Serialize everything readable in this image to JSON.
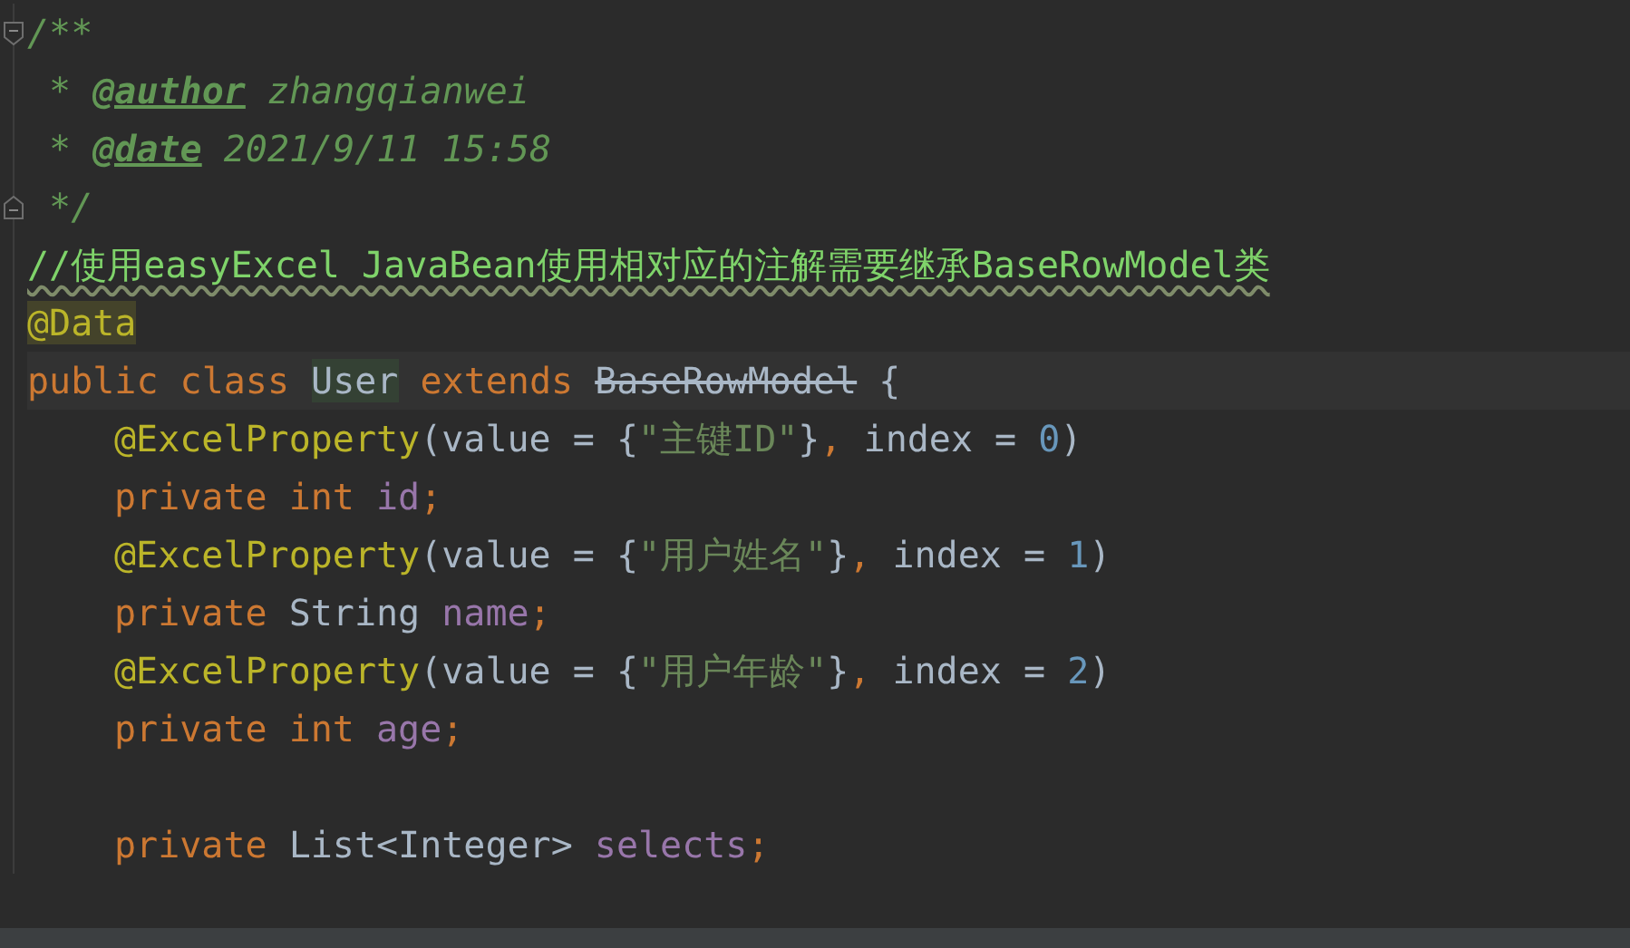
{
  "editor": {
    "lines": [
      {
        "fold_start": true,
        "fold_end": false,
        "kind": "normal",
        "indented": false,
        "tokens": [
          {
            "text": "/**",
            "kind": "doc"
          }
        ]
      },
      {
        "fold_start": false,
        "fold_end": false,
        "kind": "normal",
        "indented": false,
        "tokens": [
          {
            "text": " * ",
            "kind": "doc"
          },
          {
            "text": "@author",
            "kind": "doc-tag"
          },
          {
            "text": " zhangqianwei",
            "kind": "doc"
          }
        ]
      },
      {
        "fold_start": false,
        "fold_end": false,
        "kind": "normal",
        "indented": false,
        "tokens": [
          {
            "text": " * ",
            "kind": "doc"
          },
          {
            "text": "@date",
            "kind": "doc-tag"
          },
          {
            "text": " 2021/9/11 15:58",
            "kind": "doc"
          }
        ]
      },
      {
        "fold_start": false,
        "fold_end": true,
        "kind": "normal",
        "indented": false,
        "tokens": [
          {
            "text": " */",
            "kind": "doc"
          }
        ]
      },
      {
        "fold_start": false,
        "fold_end": false,
        "kind": "normal",
        "indented": false,
        "tokens": [
          {
            "text": "//使用easyExcel JavaBean使用相对应的注解需要继承BaseRowModel类",
            "kind": "line-comment"
          }
        ]
      },
      {
        "fold_start": false,
        "fold_end": false,
        "kind": "normal",
        "indented": false,
        "tokens": [
          {
            "text": "@Data",
            "kind": "annotation-marked"
          }
        ]
      },
      {
        "fold_start": false,
        "fold_end": false,
        "kind": "caret-line",
        "indented": false,
        "tokens": [
          {
            "text": "public class ",
            "kind": "keyword"
          },
          {
            "text": "User",
            "kind": "name-marked"
          },
          {
            "text": " extends ",
            "kind": "keyword"
          },
          {
            "text": "BaseRowModel",
            "kind": "deprecated"
          },
          {
            "text": " {",
            "kind": "plain"
          }
        ]
      },
      {
        "fold_start": false,
        "fold_end": false,
        "kind": "normal",
        "indented": true,
        "tokens": [
          {
            "text": "@ExcelProperty",
            "kind": "annotation"
          },
          {
            "text": "(value = {",
            "kind": "plain"
          },
          {
            "text": "\"主键ID\"",
            "kind": "string"
          },
          {
            "text": "}",
            "kind": "plain"
          },
          {
            "text": ",",
            "kind": "keyword"
          },
          {
            "text": " index = ",
            "kind": "plain"
          },
          {
            "text": "0",
            "kind": "number"
          },
          {
            "text": ")",
            "kind": "plain"
          }
        ]
      },
      {
        "fold_start": false,
        "fold_end": false,
        "kind": "normal",
        "indented": true,
        "tokens": [
          {
            "text": "private int ",
            "kind": "keyword"
          },
          {
            "text": "id",
            "kind": "field"
          },
          {
            "text": ";",
            "kind": "keyword"
          }
        ]
      },
      {
        "fold_start": false,
        "fold_end": false,
        "kind": "normal",
        "indented": true,
        "tokens": [
          {
            "text": "@ExcelProperty",
            "kind": "annotation"
          },
          {
            "text": "(value = {",
            "kind": "plain"
          },
          {
            "text": "\"用户姓名\"",
            "kind": "string"
          },
          {
            "text": "}",
            "kind": "plain"
          },
          {
            "text": ",",
            "kind": "keyword"
          },
          {
            "text": " index = ",
            "kind": "plain"
          },
          {
            "text": "1",
            "kind": "number"
          },
          {
            "text": ")",
            "kind": "plain"
          }
        ]
      },
      {
        "fold_start": false,
        "fold_end": false,
        "kind": "normal",
        "indented": true,
        "tokens": [
          {
            "text": "private ",
            "kind": "keyword"
          },
          {
            "text": "String ",
            "kind": "plain"
          },
          {
            "text": "name",
            "kind": "field"
          },
          {
            "text": ";",
            "kind": "keyword"
          }
        ]
      },
      {
        "fold_start": false,
        "fold_end": false,
        "kind": "normal",
        "indented": true,
        "tokens": [
          {
            "text": "@ExcelProperty",
            "kind": "annotation"
          },
          {
            "text": "(value = {",
            "kind": "plain"
          },
          {
            "text": "\"用户年龄\"",
            "kind": "string"
          },
          {
            "text": "}",
            "kind": "plain"
          },
          {
            "text": ",",
            "kind": "keyword"
          },
          {
            "text": " index = ",
            "kind": "plain"
          },
          {
            "text": "2",
            "kind": "number"
          },
          {
            "text": ")",
            "kind": "plain"
          }
        ]
      },
      {
        "fold_start": false,
        "fold_end": false,
        "kind": "normal",
        "indented": true,
        "tokens": [
          {
            "text": "private int ",
            "kind": "keyword"
          },
          {
            "text": "age",
            "kind": "field"
          },
          {
            "text": ";",
            "kind": "keyword"
          }
        ]
      },
      {
        "fold_start": false,
        "fold_end": false,
        "kind": "normal"
      },
      {
        "fold_start": false,
        "fold_end": false,
        "kind": "normal",
        "indented": true,
        "tokens": [
          {
            "text": "private ",
            "kind": "keyword"
          },
          {
            "text": "List<Integer> ",
            "kind": "plain"
          },
          {
            "text": "selects",
            "kind": "field"
          },
          {
            "text": ";",
            "kind": "keyword"
          }
        ]
      }
    ]
  }
}
